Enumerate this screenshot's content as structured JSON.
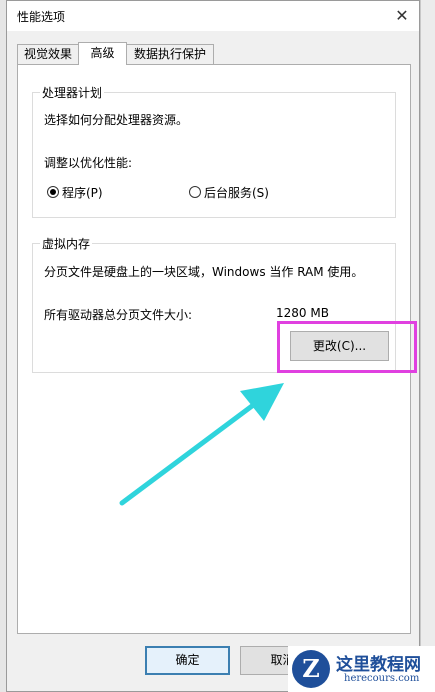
{
  "window": {
    "title": "性能选项"
  },
  "tabs": [
    {
      "label": "视觉效果"
    },
    {
      "label": "高级"
    },
    {
      "label": "数据执行保护"
    }
  ],
  "processor_group": {
    "title": "处理器计划",
    "description": "选择如何分配处理器资源。",
    "adjust_label": "调整以优化性能:",
    "options": [
      {
        "label": "程序(P)",
        "checked": true
      },
      {
        "label": "后台服务(S)",
        "checked": false
      }
    ]
  },
  "vm_group": {
    "title": "虚拟内存",
    "description": "分页文件是硬盘上的一块区域，Windows 当作 RAM 使用。",
    "total_label": "所有驱动器总分页文件大小:",
    "total_value": "1280 MB",
    "change_button": "更改(C)..."
  },
  "footer": {
    "ok": "确定",
    "cancel": "取消"
  },
  "annotations": {
    "highlight_color": "#e040e0",
    "arrow_color": "#2fd4dc"
  },
  "watermark": {
    "logo": "Z",
    "title": "这里教程网",
    "subtitle": "herecours.com"
  }
}
